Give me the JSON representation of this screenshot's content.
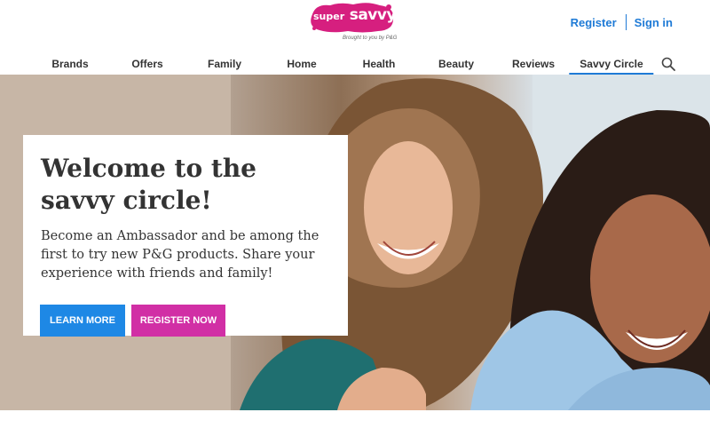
{
  "brand": {
    "logo_small": "super",
    "logo_big": "savvy me",
    "tagline": "Brought to you by P&G",
    "blob_color": "#d61f7f"
  },
  "auth": {
    "register_label": "Register",
    "signin_label": "Sign in",
    "link_color": "#1e7ad6"
  },
  "nav": {
    "items": [
      {
        "label": "Brands"
      },
      {
        "label": "Offers"
      },
      {
        "label": "Family"
      },
      {
        "label": "Home"
      },
      {
        "label": "Health"
      },
      {
        "label": "Beauty"
      },
      {
        "label": "Reviews"
      },
      {
        "label": "Savvy Circle",
        "active": true
      }
    ],
    "search_icon": "search-icon"
  },
  "hero": {
    "title": "Welcome to the savvy circle!",
    "body": "Become an Ambassador and be among the first to try new P&G products. Share your experience with friends and family!",
    "learn_more_label": "LEARN MORE",
    "register_now_label": "REGISTER NOW",
    "learn_color": "#1e88e5",
    "register_color": "#d12fa5"
  }
}
